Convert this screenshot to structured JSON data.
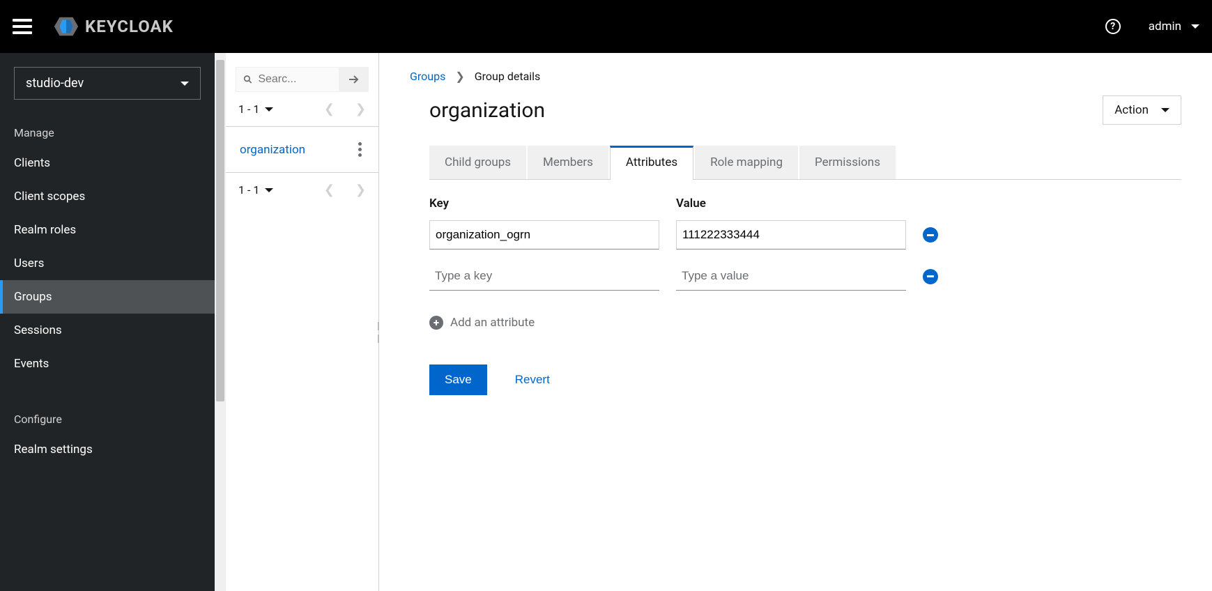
{
  "topbar": {
    "logo_text": "KEYCLOAK",
    "user": "admin"
  },
  "sidebar": {
    "realm": "studio-dev",
    "section1": "Manage",
    "items1": [
      "Clients",
      "Client scopes",
      "Realm roles",
      "Users",
      "Groups",
      "Sessions",
      "Events"
    ],
    "active_item": "Groups",
    "section2": "Configure",
    "items2": [
      "Realm settings"
    ]
  },
  "groups_panel": {
    "search_placeholder": "Searc...",
    "pager_top": "1 - 1",
    "pager_bottom": "1 - 1",
    "group": "organization"
  },
  "breadcrumb": {
    "root": "Groups",
    "current": "Group details"
  },
  "page": {
    "title": "organization",
    "action_label": "Action"
  },
  "tabs": [
    "Child groups",
    "Members",
    "Attributes",
    "Role mapping",
    "Permissions"
  ],
  "active_tab": "Attributes",
  "attrs": {
    "key_header": "Key",
    "value_header": "Value",
    "key_placeholder": "Type a key",
    "value_placeholder": "Type a value",
    "rows": [
      {
        "key": "organization_ogrn",
        "value": "111222333444"
      }
    ],
    "add_label": "Add an attribute"
  },
  "actions": {
    "save": "Save",
    "revert": "Revert"
  }
}
